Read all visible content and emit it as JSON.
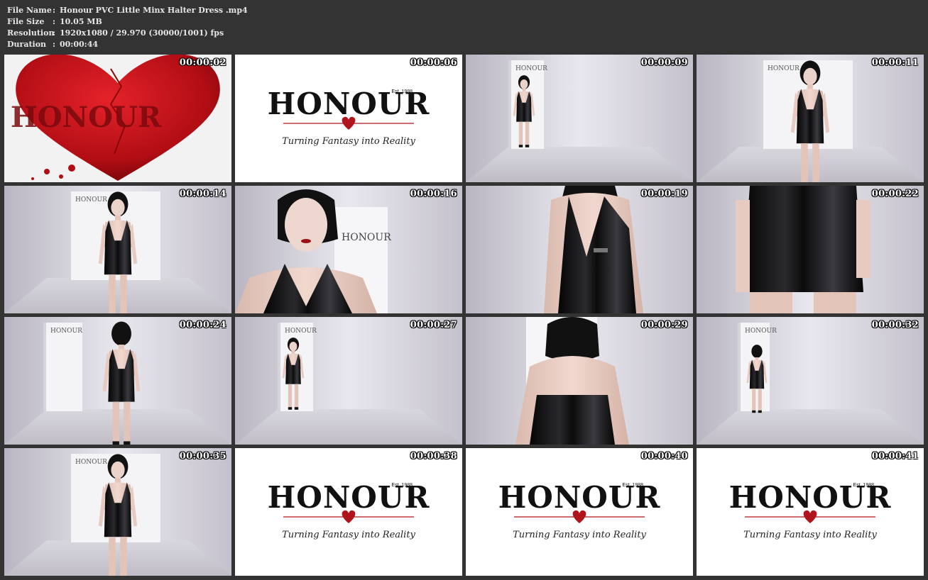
{
  "file_info": {
    "rows": [
      {
        "label": "File Name",
        "value": "Honour PVC Little Minx Halter Dress .mp4"
      },
      {
        "label": "File Size",
        "value": "10.05 MB"
      },
      {
        "label": "Resolution",
        "value": "1920x1080 / 29.970 (30000/1001) fps"
      },
      {
        "label": "Duration",
        "value": "00:00:44"
      }
    ],
    "separator": ":"
  },
  "brand": {
    "name": "HONOUR",
    "established": "Est. 1988",
    "tagline": "Turning Fantasy into Reality",
    "accent_color": "#b0141c"
  },
  "thumbnails": [
    {
      "timestamp": "00:00:02",
      "scene": "heart"
    },
    {
      "timestamp": "00:00:06",
      "scene": "logo"
    },
    {
      "timestamp": "00:00:09",
      "scene": "full"
    },
    {
      "timestamp": "00:00:11",
      "scene": "mid"
    },
    {
      "timestamp": "00:00:14",
      "scene": "mid"
    },
    {
      "timestamp": "00:00:16",
      "scene": "portrait"
    },
    {
      "timestamp": "00:00:19",
      "scene": "torso"
    },
    {
      "timestamp": "00:00:22",
      "scene": "hips"
    },
    {
      "timestamp": "00:00:24",
      "scene": "back"
    },
    {
      "timestamp": "00:00:27",
      "scene": "full"
    },
    {
      "timestamp": "00:00:29",
      "scene": "backclose"
    },
    {
      "timestamp": "00:00:32",
      "scene": "backfar"
    },
    {
      "timestamp": "00:00:35",
      "scene": "mid"
    },
    {
      "timestamp": "00:00:38",
      "scene": "logo"
    },
    {
      "timestamp": "00:00:40",
      "scene": "logo"
    },
    {
      "timestamp": "00:00:41",
      "scene": "logo"
    }
  ]
}
